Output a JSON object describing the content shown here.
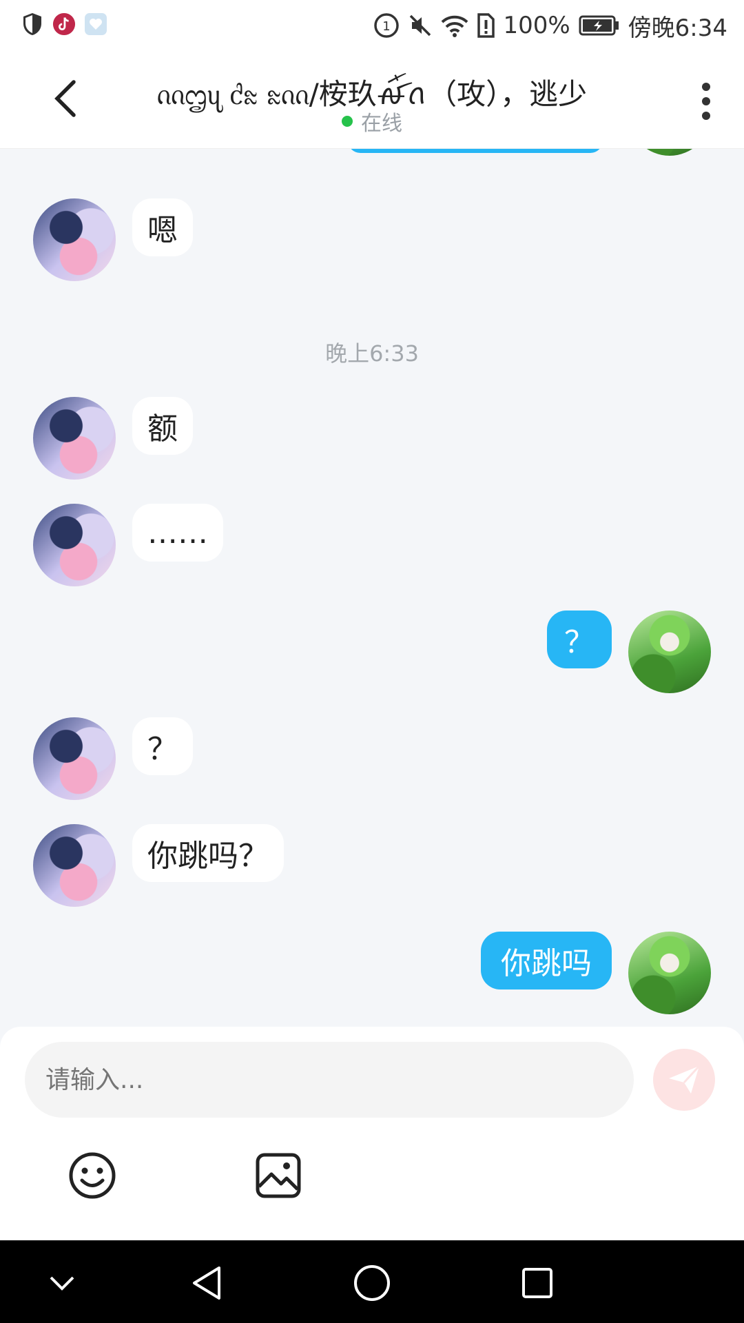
{
  "status_bar": {
    "battery": "100%",
    "time": "傍晚6:34",
    "icons": [
      "shield-icon",
      "tiktok-icon",
      "app-icon",
      "data-saver-icon",
      "mute-icon",
      "wifi-icon",
      "sim-alert-icon",
      "battery-icon"
    ]
  },
  "header": {
    "title": "ᦶᦗᦴ ᦺᦰ ᦰᦶ/桉玖ꫛꪸꪒ（攻），逃少",
    "status": "在线",
    "icons": [
      "back-icon",
      "more-icon"
    ]
  },
  "colors": {
    "accent": "#27b6f5",
    "online": "#26c24b",
    "background": "#f4f6f9"
  },
  "chat": {
    "time_separator": "晚上6:33",
    "messages": [
      {
        "side": "in",
        "text": "嗯"
      },
      {
        "side": "in",
        "text": "额"
      },
      {
        "side": "in",
        "text": "……"
      },
      {
        "side": "out",
        "text": "？"
      },
      {
        "side": "in",
        "text": "？"
      },
      {
        "side": "in",
        "text": "你跳吗？"
      },
      {
        "side": "out",
        "text": "你跳吗"
      }
    ]
  },
  "input": {
    "placeholder": "请输入..."
  },
  "toolbar": {
    "icons": [
      "emoji-icon",
      "image-icon",
      "send-icon"
    ]
  },
  "nav": {
    "icons": [
      "collapse-icon",
      "nav-back-icon",
      "home-icon",
      "recents-icon"
    ]
  }
}
